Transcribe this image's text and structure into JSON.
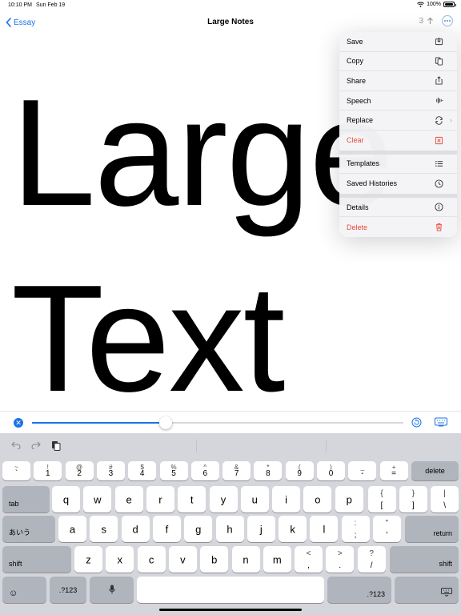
{
  "status_bar": {
    "time": "10:10 PM",
    "date": "Sun Feb 19",
    "battery": "100%",
    "battery_level": 1.0
  },
  "nav": {
    "back_label": "Essay",
    "title": "Large Notes",
    "page_count": "3"
  },
  "editor": {
    "text": "Large\nText"
  },
  "menu": {
    "groups": [
      [
        {
          "label": "Save",
          "icon": "save-icon"
        },
        {
          "label": "Copy",
          "icon": "copy-icon"
        },
        {
          "label": "Share",
          "icon": "share-icon"
        },
        {
          "label": "Speech",
          "icon": "waveform-icon"
        },
        {
          "label": "Replace",
          "icon": "replace-icon",
          "submenu": true
        },
        {
          "label": "Clear",
          "icon": "clear-icon",
          "destructive": true
        }
      ],
      [
        {
          "label": "Templates",
          "icon": "list-icon"
        },
        {
          "label": "Saved Histories",
          "icon": "clock-icon"
        }
      ],
      [
        {
          "label": "Details",
          "icon": "info-icon"
        },
        {
          "label": "Delete",
          "icon": "trash-icon",
          "destructive": true
        }
      ]
    ]
  },
  "slider": {
    "value": 0.36
  },
  "keyboard": {
    "row1": [
      {
        "top": "~",
        "bot": "`"
      },
      {
        "top": "!",
        "bot": "1"
      },
      {
        "top": "@",
        "bot": "2"
      },
      {
        "top": "#",
        "bot": "3"
      },
      {
        "top": "$",
        "bot": "4"
      },
      {
        "top": "%",
        "bot": "5"
      },
      {
        "top": "^",
        "bot": "6"
      },
      {
        "top": "&",
        "bot": "7"
      },
      {
        "top": "*",
        "bot": "8"
      },
      {
        "top": "(",
        "bot": "9"
      },
      {
        "top": ")",
        "bot": "0"
      },
      {
        "top": "_",
        "bot": "-"
      },
      {
        "top": "+",
        "bot": "="
      }
    ],
    "delete": "delete",
    "tab": "tab",
    "row2": [
      "q",
      "w",
      "e",
      "r",
      "t",
      "y",
      "u",
      "i",
      "o",
      "p"
    ],
    "row2_sym": [
      {
        "top": "{",
        "bot": "["
      },
      {
        "top": "}",
        "bot": "]"
      },
      {
        "top": "|",
        "bot": "\\"
      }
    ],
    "lang": "あいう",
    "row3": [
      "a",
      "s",
      "d",
      "f",
      "g",
      "h",
      "j",
      "k",
      "l"
    ],
    "row3_sym": [
      {
        "top": ":",
        "bot": ";"
      },
      {
        "top": "\"",
        "bot": "'"
      }
    ],
    "return": "return",
    "shift": "shift",
    "row4": [
      "z",
      "x",
      "c",
      "v",
      "b",
      "n",
      "m"
    ],
    "row4_sym": [
      {
        "top": "<",
        "bot": ","
      },
      {
        "top": ">",
        "bot": "."
      },
      {
        "top": "?",
        "bot": "/"
      }
    ],
    "num_key": ".?123"
  },
  "colors": {
    "accent": "#1a73e8",
    "destructive": "#e74a3b",
    "keyboard_bg": "#d4d6dc",
    "dark_key": "#b0b4bd"
  }
}
